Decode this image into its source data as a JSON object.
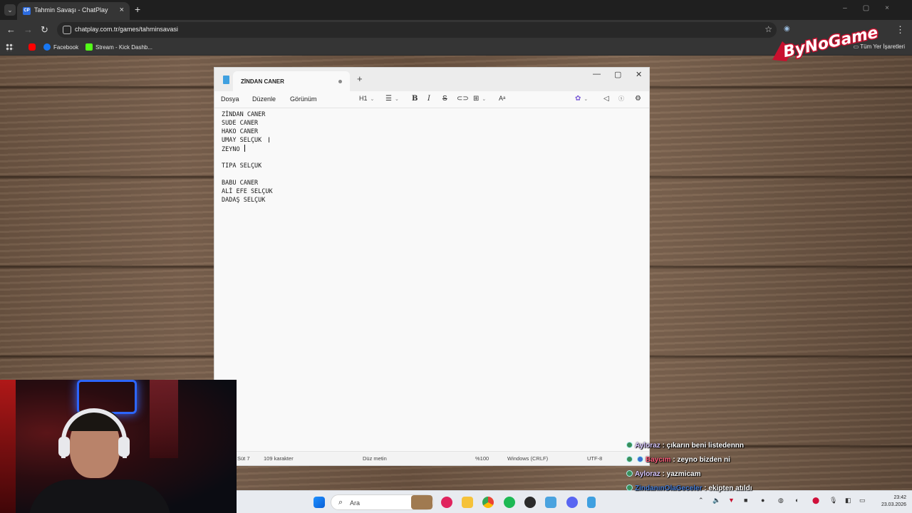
{
  "browser": {
    "tab_title": "Tahmin Savaşı - ChatPlay",
    "tab_favicon_text": "CP",
    "url": "chatplay.com.tr/games/tahminsavasi",
    "bookmarks": [
      {
        "label": "",
        "icon": "youtube-icon",
        "color": "#ff0000"
      },
      {
        "label": "Facebook",
        "icon": "facebook-icon",
        "color": "#1877f2"
      },
      {
        "label": "Stream - Kick Dashb...",
        "icon": "kick-icon",
        "color": "#53fc18"
      }
    ],
    "all_bookmarks_label": "Tüm Yer İşaretleri"
  },
  "overlay_logo": "ByNoGame",
  "notepad": {
    "tab_title": "ZİNDAN CANER",
    "menu": [
      "Dosya",
      "Düzenle",
      "Görünüm"
    ],
    "heading_tool": "H1",
    "lines": [
      "ZİNDAN CANER",
      "SUDE CANER",
      "HAKO CANER",
      "UMAY SELÇUK",
      "ZEYNO ",
      "",
      "TIPA SELÇUK",
      "",
      "BABU CANER",
      "ALİ EFE SELÇUK",
      "DADAŞ SELÇUK"
    ],
    "status": {
      "position": "Süt 7",
      "chars": "109 karakter",
      "format": "Düz metin",
      "zoom": "%100",
      "line_endings": "Windows (CRLF)",
      "encoding": "UTF-8"
    }
  },
  "taskbar": {
    "search_placeholder": "Ara",
    "time": "23:42",
    "date": "23.03.2026"
  },
  "chat": [
    {
      "user": "Ayloraz",
      "text": ": çıkarın beni listedennn",
      "user_color": "#d9c7ff"
    },
    {
      "user": "Baycım",
      "text": ": zeyno bizden ni",
      "user_color": "#ff5a7a"
    },
    {
      "user": "Ayloraz",
      "text": ": yazmicam",
      "user_color": "#d9c7ff"
    },
    {
      "user": "ZindanınOlaGeceler",
      "text": ": ekipten atıldı",
      "user_color": "#4a7fd6"
    }
  ]
}
